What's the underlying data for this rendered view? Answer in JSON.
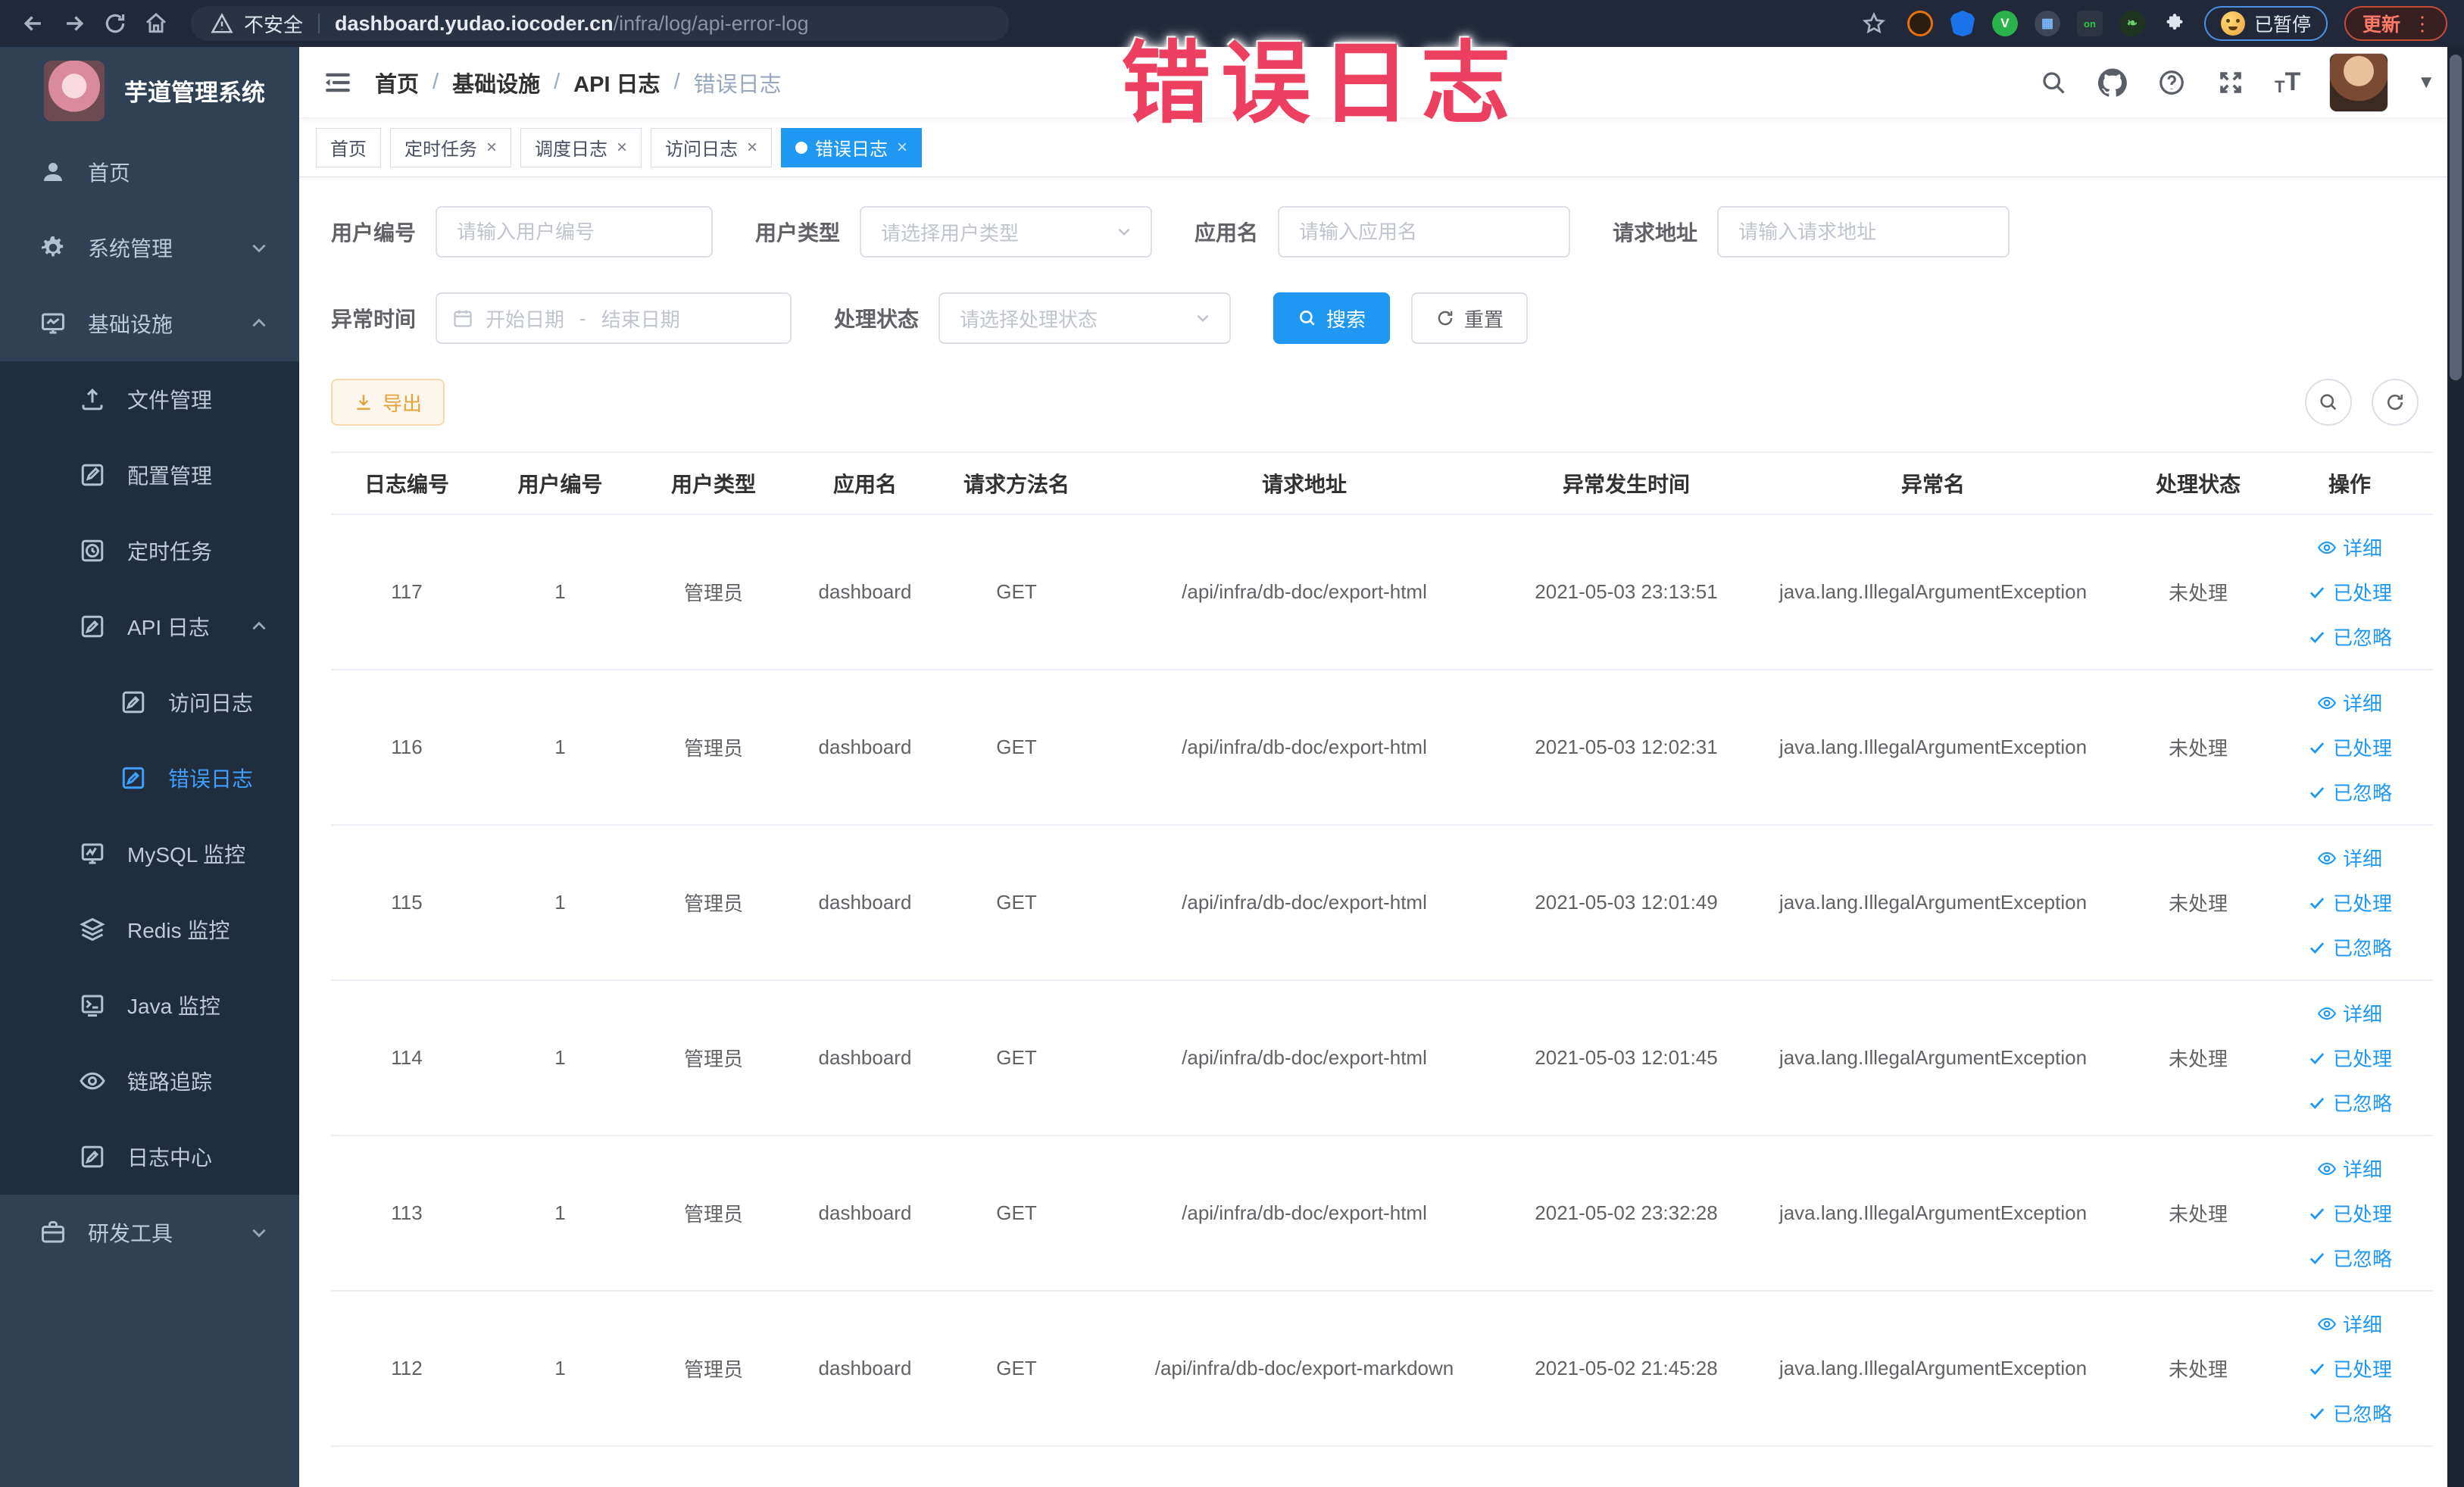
{
  "browser": {
    "security_label": "不安全",
    "url_host": "dashboard.yudao.iocoder.cn",
    "url_path": "/infra/log/api-error-log",
    "paused_badge": "已暂停",
    "update_button": "更新",
    "menu_dots": "⋮"
  },
  "annotation": {
    "text": "错误日志",
    "color": "#ed3f5f"
  },
  "colors": {
    "accent": "#1f98f4",
    "element_blue": "#409EFF",
    "warning": "#e6a23c",
    "sidebar_bg": "#304156",
    "submenu_bg": "#1f2d3d",
    "chrome_bar_bg": "#202839"
  },
  "sidebar": {
    "title": "芋道管理系统",
    "items": [
      {
        "id": "home",
        "label": "首页",
        "icon": "user-icon",
        "level": 1
      },
      {
        "id": "system",
        "label": "系统管理",
        "icon": "gear-icon",
        "level": 1,
        "chevron": "down"
      },
      {
        "id": "infra",
        "label": "基础设施",
        "icon": "monitor-icon",
        "level": 1,
        "chevron": "up"
      },
      {
        "id": "file",
        "label": "文件管理",
        "icon": "upload-icon",
        "level": 2
      },
      {
        "id": "config",
        "label": "配置管理",
        "icon": "edit-icon",
        "level": 2
      },
      {
        "id": "job",
        "label": "定时任务",
        "icon": "clock-icon",
        "level": 2
      },
      {
        "id": "api-log",
        "label": "API 日志",
        "icon": "log-icon",
        "level": 2,
        "chevron": "up"
      },
      {
        "id": "access-log",
        "label": "访问日志",
        "icon": "log-icon",
        "level": 3
      },
      {
        "id": "error-log",
        "label": "错误日志",
        "icon": "log-icon",
        "level": 3,
        "active": true
      },
      {
        "id": "mysql",
        "label": "MySQL 监控",
        "icon": "database-icon",
        "level": 2
      },
      {
        "id": "redis",
        "label": "Redis 监控",
        "icon": "layers-icon",
        "level": 2
      },
      {
        "id": "java",
        "label": "Java 监控",
        "icon": "java-icon",
        "level": 2
      },
      {
        "id": "trace",
        "label": "链路追踪",
        "icon": "eye-icon",
        "level": 2
      },
      {
        "id": "log-center",
        "label": "日志中心",
        "icon": "log-icon",
        "level": 2
      },
      {
        "id": "devtools",
        "label": "研发工具",
        "icon": "tools-icon",
        "level": 1,
        "chevron": "down"
      }
    ]
  },
  "breadcrumb": {
    "items": [
      "首页",
      "基础设施",
      "API 日志",
      "错误日志"
    ],
    "separator": "/"
  },
  "tabs": [
    {
      "id": "home",
      "label": "首页",
      "closable": false,
      "active": false
    },
    {
      "id": "job",
      "label": "定时任务",
      "closable": true,
      "active": false
    },
    {
      "id": "job-log",
      "label": "调度日志",
      "closable": true,
      "active": false
    },
    {
      "id": "api-access",
      "label": "访问日志",
      "closable": true,
      "active": false
    },
    {
      "id": "api-error",
      "label": "错误日志",
      "closable": true,
      "active": true
    }
  ],
  "filters": [
    {
      "label": "用户编号",
      "placeholder": "请输入用户编号",
      "type": "input"
    },
    {
      "label": "用户类型",
      "placeholder": "请选择用户类型",
      "type": "select"
    },
    {
      "label": "应用名",
      "placeholder": "请输入应用名",
      "type": "input"
    },
    {
      "label": "请求地址",
      "placeholder": "请输入请求地址",
      "type": "input"
    },
    {
      "label": "异常时间",
      "start_placeholder": "开始日期",
      "separator": "-",
      "end_placeholder": "结束日期",
      "type": "daterange"
    },
    {
      "label": "处理状态",
      "placeholder": "请选择处理状态",
      "type": "select"
    }
  ],
  "actions": {
    "search": "搜索",
    "reset": "重置",
    "export": "导出"
  },
  "table": {
    "columns": [
      "日志编号",
      "用户编号",
      "用户类型",
      "应用名",
      "请求方法名",
      "请求地址",
      "异常发生时间",
      "异常名",
      "处理状态",
      "操作"
    ],
    "row_actions": [
      {
        "id": "detail",
        "label": "详细",
        "icon": "eye-icon"
      },
      {
        "id": "processed",
        "label": "已处理",
        "icon": "check-icon"
      },
      {
        "id": "ignored",
        "label": "已忽略",
        "icon": "check-icon"
      }
    ],
    "rows": [
      [
        "117",
        "1",
        "管理员",
        "dashboard",
        "GET",
        "/api/infra/db-doc/export-html",
        "2021-05-03 23:13:51",
        "java.lang.IllegalArgumentException",
        "未处理"
      ],
      [
        "116",
        "1",
        "管理员",
        "dashboard",
        "GET",
        "/api/infra/db-doc/export-html",
        "2021-05-03 12:02:31",
        "java.lang.IllegalArgumentException",
        "未处理"
      ],
      [
        "115",
        "1",
        "管理员",
        "dashboard",
        "GET",
        "/api/infra/db-doc/export-html",
        "2021-05-03 12:01:49",
        "java.lang.IllegalArgumentException",
        "未处理"
      ],
      [
        "114",
        "1",
        "管理员",
        "dashboard",
        "GET",
        "/api/infra/db-doc/export-html",
        "2021-05-03 12:01:45",
        "java.lang.IllegalArgumentException",
        "未处理"
      ],
      [
        "113",
        "1",
        "管理员",
        "dashboard",
        "GET",
        "/api/infra/db-doc/export-html",
        "2021-05-02 23:32:28",
        "java.lang.IllegalArgumentException",
        "未处理"
      ],
      [
        "112",
        "1",
        "管理员",
        "dashboard",
        "GET",
        "/api/infra/db-doc/export-markdown",
        "2021-05-02 21:45:28",
        "java.lang.IllegalArgumentException",
        "未处理"
      ]
    ]
  }
}
